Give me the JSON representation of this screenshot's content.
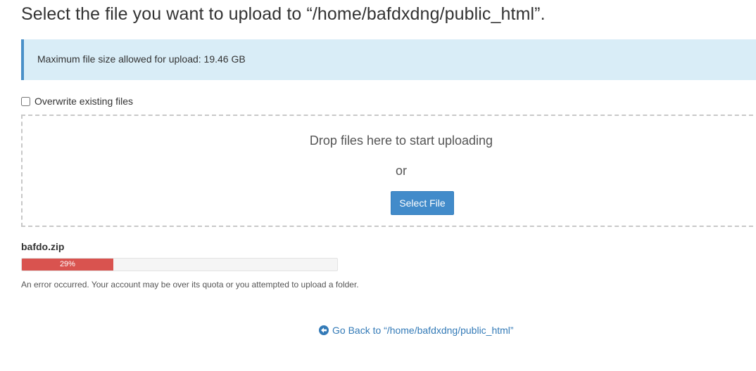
{
  "page": {
    "title": "Select the file you want to upload to “/home/bafdxdng/public_html”."
  },
  "info": {
    "max_size_text": "Maximum file size allowed for upload: 19.46 GB"
  },
  "overwrite": {
    "label": "Overwrite existing files",
    "checked": false
  },
  "dropzone": {
    "drop_text": "Drop files here to start uploading",
    "or_text": "or",
    "select_button_label": "Select File"
  },
  "upload": {
    "file_name": "bafdo.zip",
    "progress_percent": 29,
    "progress_label": "29%",
    "error_message": "An error occurred. Your account may be over its quota or you attempted to upload a folder."
  },
  "navigation": {
    "go_back_label": "Go Back to “/home/bafdxdng/public_html”"
  },
  "colors": {
    "accent": "#428bca",
    "link": "#337ab7",
    "info_bg": "#d9edf7",
    "error_bar": "#d9534f"
  }
}
